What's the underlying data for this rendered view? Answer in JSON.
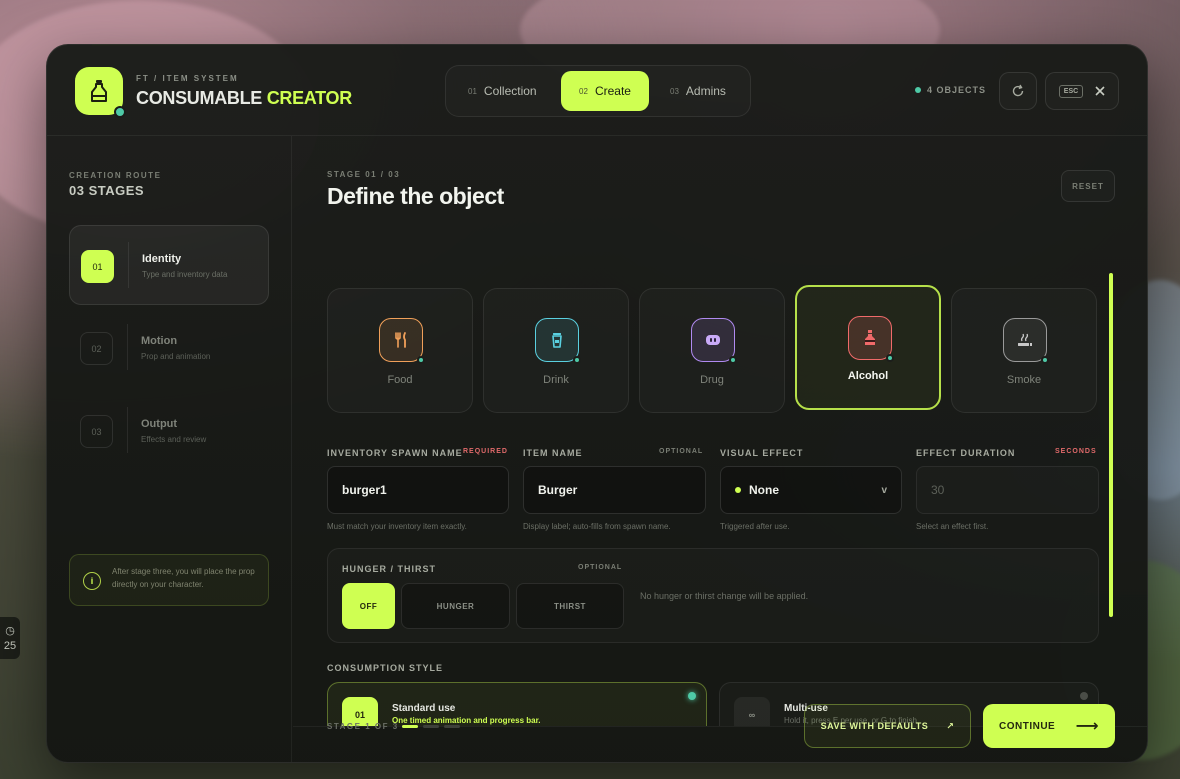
{
  "brand": {
    "subtitle": "FT / ITEM SYSTEM",
    "title_main": "CONSUMABLE",
    "title_accent": "CREATOR",
    "accent_color": "#cfff52"
  },
  "tabs": [
    {
      "num": "01",
      "label": "Collection",
      "active": false
    },
    {
      "num": "02",
      "label": "Create",
      "active": true
    },
    {
      "num": "03",
      "label": "Admins",
      "active": false
    }
  ],
  "header": {
    "object_count": "4 OBJECTS",
    "esc_label": "ESC"
  },
  "sidebar": {
    "route_label": "CREATION ROUTE",
    "route_title": "03 STAGES",
    "steps": [
      {
        "num": "01",
        "title": "Identity",
        "desc": "Type and inventory data",
        "active": true
      },
      {
        "num": "02",
        "title": "Motion",
        "desc": "Prop and animation",
        "active": false
      },
      {
        "num": "03",
        "title": "Output",
        "desc": "Effects and review",
        "active": false
      }
    ],
    "info_icon": "i",
    "info_text": "After stage three, you will place the prop directly on your character."
  },
  "main": {
    "stage_label": "STAGE 01 / 03",
    "stage_title": "Define the object",
    "reset_label": "RESET",
    "types": [
      {
        "label": "Food",
        "icon": "fork-knife-icon",
        "color": "#f0a05a",
        "selected": false
      },
      {
        "label": "Drink",
        "icon": "cup-icon",
        "color": "#5ad0e0",
        "selected": false
      },
      {
        "label": "Drug",
        "icon": "pill-icon",
        "color": "#b08af0",
        "selected": false
      },
      {
        "label": "Alcohol",
        "icon": "bottle-icon",
        "color": "#f06a6a",
        "selected": true
      },
      {
        "label": "Smoke",
        "icon": "smoke-icon",
        "color": "#c8c8c8",
        "selected": false
      }
    ],
    "fields": {
      "spawn": {
        "label": "INVENTORY SPAWN NAME",
        "tag": "REQUIRED",
        "value": "burger1",
        "hint": "Must match your inventory item exactly."
      },
      "item": {
        "label": "ITEM NAME",
        "tag": "OPTIONAL",
        "value": "Burger",
        "hint": "Display label; auto-fills from spawn name."
      },
      "effect": {
        "label": "VISUAL EFFECT",
        "value": "None",
        "caret": "v",
        "hint": "Triggered after use."
      },
      "duration": {
        "label": "EFFECT DURATION",
        "tag": "SECONDS",
        "placeholder": "30",
        "hint": "Select an effect first."
      }
    },
    "hunger": {
      "label": "HUNGER / THIRST",
      "tag": "OPTIONAL",
      "options": [
        "OFF",
        "HUNGER",
        "THIRST"
      ],
      "selected": "OFF",
      "message": "No hunger or thirst change will be applied."
    },
    "consumption": {
      "label": "CONSUMPTION STYLE",
      "options": [
        {
          "num": "01",
          "title": "Standard use",
          "desc": "One timed animation and progress bar.",
          "active": true
        },
        {
          "num": "∞",
          "title": "Multi-use",
          "desc": "Hold it, press E per use, or G to finish.",
          "active": false
        }
      ]
    },
    "footer": {
      "stage_count": "STAGE 1 OF 3",
      "progress_current": 1,
      "progress_total": 3,
      "save_label": "SAVE WITH DEFAULTS",
      "save_arrow": "↗",
      "continue_label": "CONTINUE",
      "continue_arrow": "⟶"
    }
  },
  "hud": {
    "clock_value": "25"
  }
}
